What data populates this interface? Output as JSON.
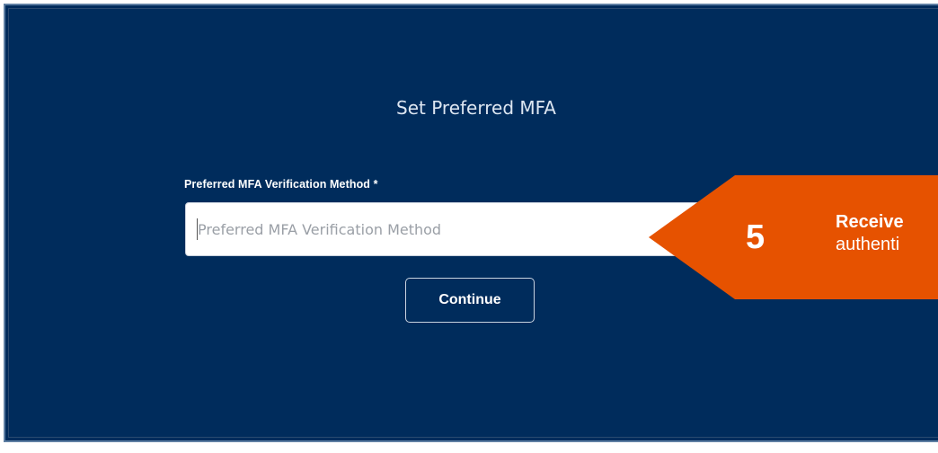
{
  "form": {
    "title": "Set Preferred MFA",
    "field_label": "Preferred MFA Verification Method *",
    "field_placeholder": "Preferred MFA Verification Method",
    "field_value": "",
    "continue_label": "Continue"
  },
  "callout": {
    "number": "5",
    "line1": "Receive",
    "line2": "authenti"
  },
  "colors": {
    "panel_bg": "#002c5c",
    "callout": "#e65200",
    "button_border": "#c9d3e0"
  }
}
